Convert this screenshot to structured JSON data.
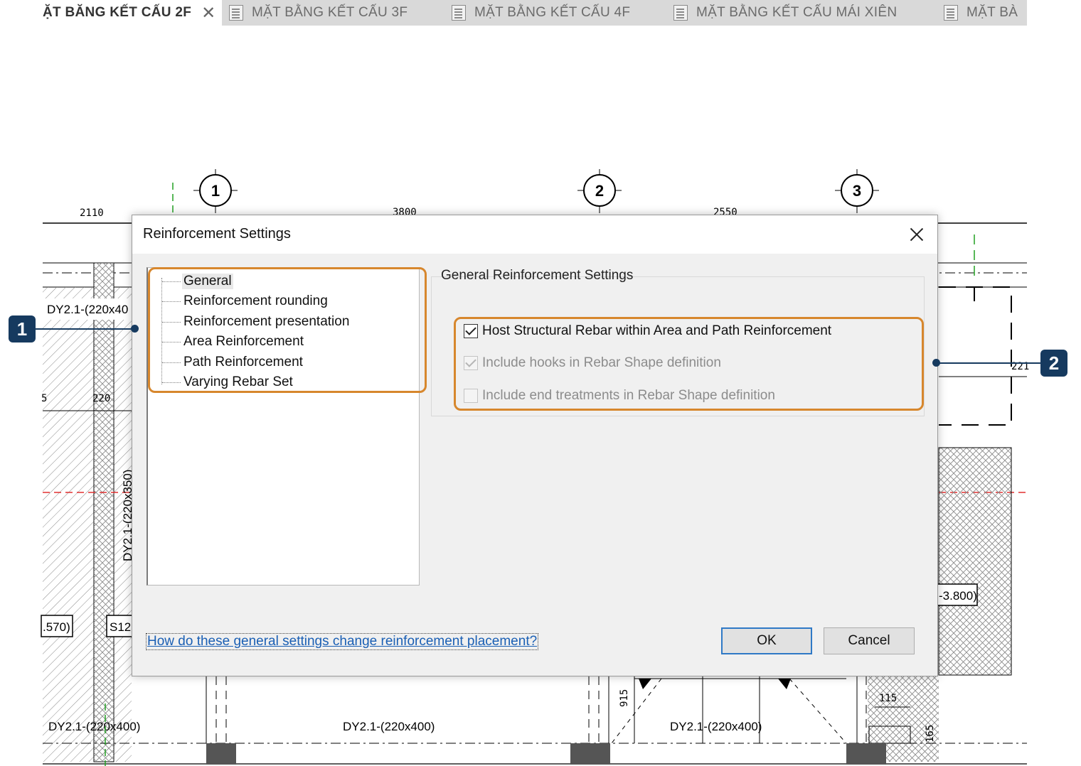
{
  "tabs": [
    {
      "label": "ẶT BĂNG KẾT CẤU 2F",
      "active": true,
      "close": "✕"
    },
    {
      "label": "MẶT BẰNG KẾT CẤU 3F",
      "active": false
    },
    {
      "label": "MẶT BẰNG KẾT CẤU 4F",
      "active": false
    },
    {
      "label": "MẶT BẰNG KẾT CẤU MÁI XIÊN",
      "active": false
    },
    {
      "label": "MẶT BÀ",
      "active": false
    }
  ],
  "drawing": {
    "grid_bubbles": [
      "1",
      "2",
      "3"
    ],
    "dimensions": [
      "2110",
      "3800",
      "2550",
      "220",
      "5",
      "915",
      "115",
      "165",
      "221"
    ],
    "labels": [
      "DY2.1-(220x40",
      "DY2.1-(220x350)",
      "DY2.1-(220x400)",
      "DY2.1-(220x400)",
      "DY2.1-(220x400)",
      ".570)",
      "S12",
      "-3.800)"
    ]
  },
  "dialog": {
    "title": "Reinforcement Settings",
    "tree_items": [
      {
        "label": "General",
        "selected": true
      },
      {
        "label": "Reinforcement rounding",
        "selected": false
      },
      {
        "label": "Reinforcement presentation",
        "selected": false
      },
      {
        "label": "Area Reinforcement",
        "selected": false
      },
      {
        "label": "Path Reinforcement",
        "selected": false
      },
      {
        "label": "Varying Rebar Set",
        "selected": false
      }
    ],
    "group_title": "General Reinforcement Settings",
    "options": [
      {
        "label": "Host Structural Rebar within Area and Path Reinforcement",
        "checked": true,
        "enabled": true
      },
      {
        "label": "Include hooks in Rebar Shape definition",
        "checked": true,
        "enabled": false
      },
      {
        "label": "Include end treatments in Rebar Shape definition",
        "checked": false,
        "enabled": false
      }
    ],
    "help_link": "How do these general settings change reinforcement placement?",
    "ok_label": "OK",
    "cancel_label": "Cancel"
  },
  "callouts": [
    "1",
    "2"
  ],
  "colors": {
    "highlight": "#d7872d",
    "callout": "#163a5f",
    "link": "#1a5fb4",
    "ok_border": "#2f79c6",
    "grid_dash_red": "#e03030"
  }
}
